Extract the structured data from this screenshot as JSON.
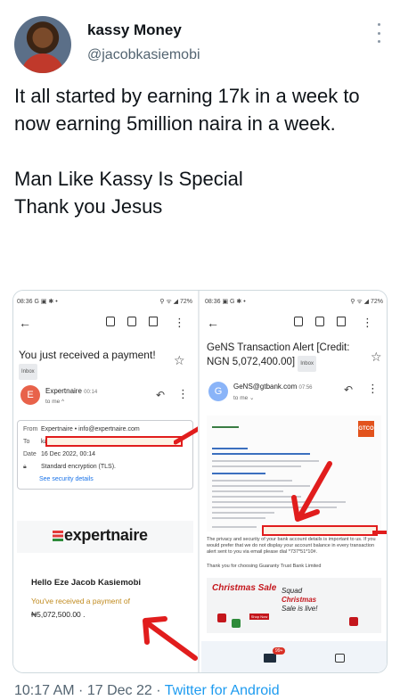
{
  "author": {
    "name": "kassy Money",
    "handle": "@jacobkasiemobi"
  },
  "tweet": {
    "line1": "It all started by earning 17k in a week to now earning 5million naira in a week.",
    "line2": "Man Like Kassy Is Special",
    "line3": "Thank you Jesus"
  },
  "left_shot": {
    "status_time": "08:36 G ▣ ✱ •",
    "status_sys": "⚲ ᯤ ◢ 72%",
    "subject": "You just received a payment!",
    "inbox_label": "Inbox",
    "avatar_letter": "E",
    "sender": "Expertnaire",
    "sent_time": "00:14",
    "to_me": "to me ^",
    "from_label": "From",
    "from_value": "Expertnaire • info@expertnaire.com",
    "to_label": "To",
    "to_value": "kassy",
    "date_label": "Date",
    "date_value": "16 Dec 2022, 00:14",
    "encryption": "Standard encryption (TLS).",
    "security_link": "See security details",
    "brand": "expertnaire",
    "hello": "Hello Eze Jacob Kasiemobi",
    "received": "You've received a payment of",
    "amount": "₦5,072,500.00 ."
  },
  "right_shot": {
    "status_time": "08:36 ▣ G ✱ •",
    "status_sys": "⚲ ᯤ ◢ 72%",
    "subject_line1": "GeNS Transaction Alert [Credit:",
    "subject_line2": "NGN 5,072,400.00]",
    "inbox_label": "Inbox",
    "avatar_letter": "G",
    "sender": "GeNS@gtbank.com",
    "sent_time": "07:56",
    "to_me": "to me ⌄",
    "gt_logo": "GTCO",
    "privacy": "The privacy and security of your bank account details is important to us. If you would prefer that we do not display your account balance in every transaction alert sent to you via email please dial *737*51*10#.",
    "thanks": "Thank you for choosing Guaranty Trust Bank Limited",
    "banner_christmas": "Christmas Sale",
    "banner_squad": "Squad",
    "banner_christmas2": "Christmas",
    "banner_sale": "Sale is live!",
    "banner_shop": "Shop Now",
    "mail_badge": "99+"
  },
  "footer": {
    "datetime": "10:17 AM · 17 Dec 22 · ",
    "app": "Twitter for Android"
  },
  "colors": {
    "accent": "#1d9bf0",
    "arrow_red": "#e11d1d",
    "secondary_text": "#536471"
  }
}
